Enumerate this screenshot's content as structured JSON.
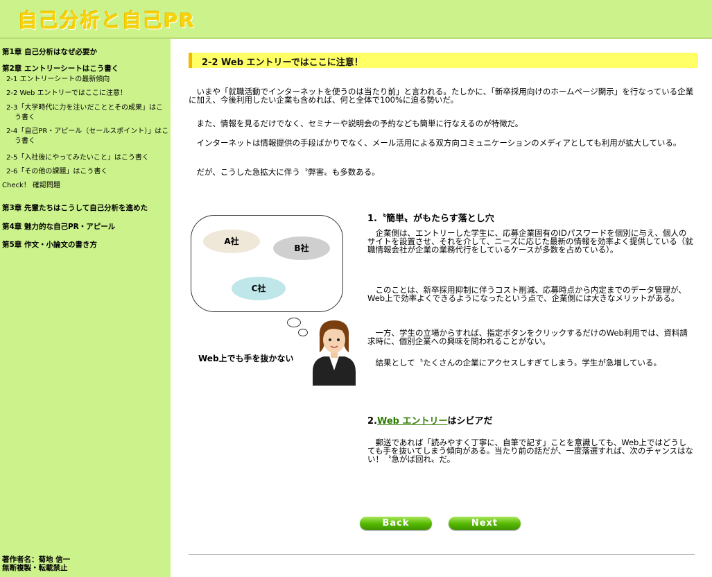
{
  "site": {
    "title": "自己分析と自己PR"
  },
  "sidebar": {
    "chapters": [
      {
        "label": "第1章 自己分析はなぜ必要か"
      },
      {
        "label": "第2章 エントリーシートはこう書く"
      },
      {
        "label": "第3章 先輩たちはこうして自己分析を進めた"
      },
      {
        "label": "第4章 魅力的な自己PR・アピール"
      },
      {
        "label": "第5章 作文・小論文の書き方"
      }
    ],
    "sections": [
      {
        "label": "2-1 エントリーシートの最新傾向"
      },
      {
        "label": "2-2 Web エントリーではここに注意！"
      },
      {
        "label": "2-3「大学時代に力を注いだこととその成果」はこう書く"
      },
      {
        "label": "2-4「自己PR・アピール（セールスポイント）」はこう書く"
      },
      {
        "label": "2-5「入社後にやってみたいこと」はこう書く"
      },
      {
        "label": "2-6「その他の課題」はこう書く"
      },
      {
        "label": "Check！ 確認問題"
      }
    ],
    "credits": [
      "著作者名：菊地 信一",
      "無断複製・転載禁止"
    ]
  },
  "main": {
    "section_title": "2-2  Web エントリーではここに注意！",
    "intro": [
      "いまや「就職活動でインターネットを使うのは当たり前」と言われる。たしかに、「新卒採用向けのホームページ開示」を行なっている企業に加え、今後利用したい企業も含めれば、何と全体で100%に迫る勢いだ。",
      "また、情報を見るだけでなく、セミナーや説明会の予約なども簡単に行なえるのが特徴だ。",
      "インターネットは情報提供の手段ばかりでなく、メール活用による双方向コミュニケーションのメディアとしても利用が拡大している。",
      "だが、こうした急拡大に伴う〝弊害〟も多数ある。"
    ],
    "illustration": {
      "company_a": "A社",
      "company_b": "B社",
      "company_c": "C社",
      "caption": "Web上でも手を抜かない"
    },
    "sub1": {
      "heading": "1.〝簡単〟がもたらす落とし穴",
      "paragraphs": [
        "企業側は、エントリーした学生に、応募企業固有のIDパスワードを個別に与え、個人のサイトを設置させ、それを介して、ニーズに応じた最新の情報を効率よく提供している（就職情報会社が企業の業務代行をしているケースが多数を占めている）。",
        "このことは、新卒採用抑制に伴うコスト削減、応募時点から内定までのデータ管理が、Web上で効率よくできるようになったという点で、企業側には大きなメリットがある。",
        "一方、学生の立場からすれば、指定ボタンをクリックするだけのWeb利用では、資料請求時に、個別企業への興味を問われることがない。",
        "結果として〝たくさんの企業にアクセスしすぎてしまう〟学生が急増している。"
      ]
    },
    "sub2": {
      "number": "2.",
      "link": "Web エントリー",
      "heading_rest": "はシビアだ",
      "paragraphs": [
        "郵送であれば「読みやすく丁寧に、自筆で記す」ことを意識しても、Web上ではどうしても手を抜いてしまう傾向がある。当たり前の話だが、一度落選すれば、次のチャンスはない！〝急がば回れ〟だ。"
      ]
    },
    "nav": {
      "back": "Back",
      "next": "Next"
    }
  },
  "colors": {
    "header_bg": "#ccf28c",
    "title_yellow": "#f9d20a",
    "section_bar": "#ffff66",
    "section_accent": "#f3b800",
    "link_green": "#2c7a00",
    "button_green": "#55b800"
  }
}
